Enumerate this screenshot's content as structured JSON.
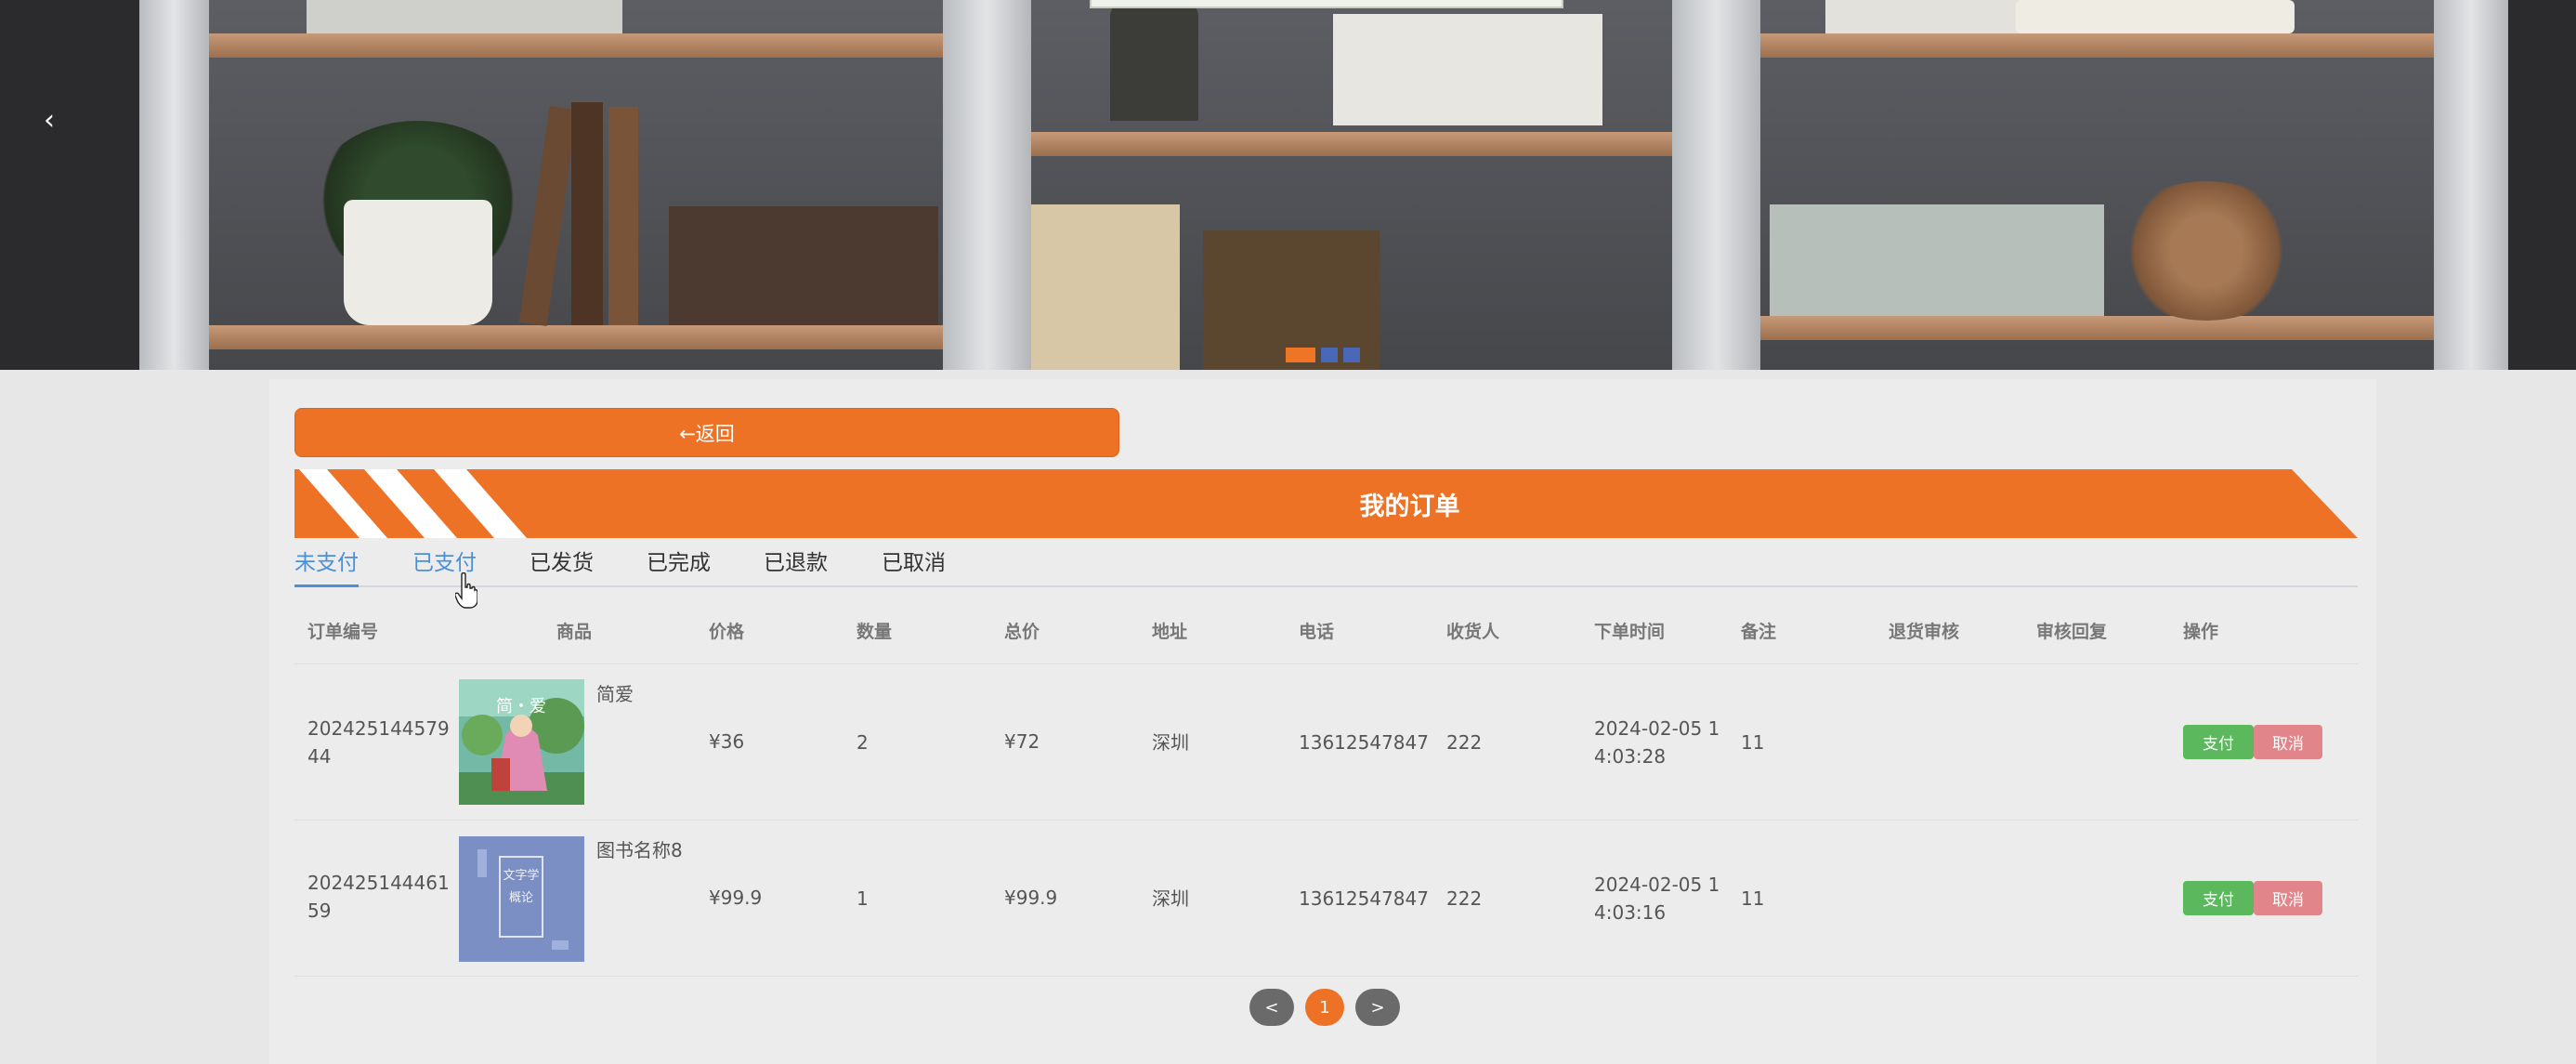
{
  "banner": {
    "prev_icon": "chevron-left-icon",
    "prev_glyph": "‹",
    "slides": 3,
    "active_slide": 1
  },
  "back_button": {
    "label": "←返回"
  },
  "page_title": "我的订单",
  "tabs": [
    {
      "label": "未支付",
      "active": true
    },
    {
      "label": "已支付",
      "active": false
    },
    {
      "label": "已发货",
      "active": false
    },
    {
      "label": "已完成",
      "active": false
    },
    {
      "label": "已退款",
      "active": false
    },
    {
      "label": "已取消",
      "active": false
    }
  ],
  "table": {
    "columns": [
      "订单编号",
      "商品",
      "价格",
      "数量",
      "总价",
      "地址",
      "电话",
      "收货人",
      "下单时间",
      "备注",
      "退货审核",
      "审核回复",
      "操作"
    ],
    "rows": [
      {
        "order_no_1": "202425144579",
        "order_no_2": "44",
        "product_name": "简爱",
        "cover_text": "简・爱",
        "price": "¥36",
        "quantity": "2",
        "total": "¥72",
        "address": "深圳",
        "phone": "13612547847",
        "receiver": "222",
        "time_1": "2024-02-05 1",
        "time_2": "4:03:28",
        "note": "11",
        "pay_label": "支付",
        "cancel_label": "取消"
      },
      {
        "order_no_1": "202425144461",
        "order_no_2": "59",
        "product_name": "图书名称8",
        "cover_text": "文字学概论",
        "price": "¥99.9",
        "quantity": "1",
        "total": "¥99.9",
        "address": "深圳",
        "phone": "13612547847",
        "receiver": "222",
        "time_1": "2024-02-05 1",
        "time_2": "4:03:16",
        "note": "11",
        "pay_label": "支付",
        "cancel_label": "取消"
      }
    ]
  },
  "pagination": {
    "prev": "<",
    "current": "1",
    "next": ">"
  },
  "colors": {
    "accent": "#ee7226",
    "tab_active": "#4a90d9",
    "pay": "#5cb85c",
    "cancel": "#e2858a"
  }
}
